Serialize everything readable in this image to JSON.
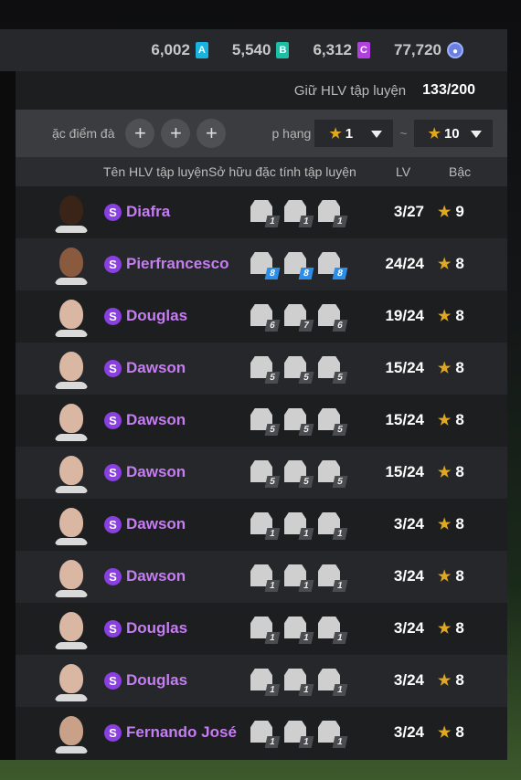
{
  "colors": {
    "accent_purple": "#c67cf2",
    "star_gold": "#e0a820",
    "badge_a": "#19b3e0",
    "badge_b": "#1bbfa5",
    "badge_c": "#b33fe0",
    "trait_blue": "#2d8ee8"
  },
  "currencies": [
    {
      "value": "6,002",
      "badge": "A",
      "color": "#19b3e0"
    },
    {
      "value": "5,540",
      "badge": "B",
      "color": "#1bbfa5"
    },
    {
      "value": "6,312",
      "badge": "C",
      "color": "#b33fe0"
    },
    {
      "value": "77,720",
      "badge": "coin-icon",
      "color": "#6b7fe0"
    }
  ],
  "keep": {
    "label": "Giữ HLV tập luyện",
    "value": "133/200"
  },
  "filters": {
    "traits_label": "ặc điểm đà",
    "rank_label": "p hạng",
    "min_rank": "1",
    "max_rank": "10",
    "tilde": "~"
  },
  "headers": {
    "name": "Tên HLV tập luyện",
    "traits": "Sở hữu đặc tính tập luyện",
    "lv": "LV",
    "rank": "Bậc"
  },
  "players": [
    {
      "name": "Diafra",
      "lv": "3/27",
      "rank": "9",
      "skin": "#3a2418",
      "traits": [
        {
          "lv": "1",
          "blue": false
        },
        {
          "lv": "1",
          "blue": false
        },
        {
          "lv": "1",
          "blue": false
        }
      ]
    },
    {
      "name": "Pierfrancesco",
      "lv": "24/24",
      "rank": "8",
      "skin": "#8a5a3e",
      "traits": [
        {
          "lv": "8",
          "blue": true
        },
        {
          "lv": "8",
          "blue": true
        },
        {
          "lv": "8",
          "blue": true
        }
      ]
    },
    {
      "name": "Douglas",
      "lv": "19/24",
      "rank": "8",
      "skin": "#d9b7a3",
      "traits": [
        {
          "lv": "6",
          "blue": false
        },
        {
          "lv": "7",
          "blue": false
        },
        {
          "lv": "6",
          "blue": false
        }
      ]
    },
    {
      "name": "Dawson",
      "lv": "15/24",
      "rank": "8",
      "skin": "#d9b7a3",
      "traits": [
        {
          "lv": "5",
          "blue": false
        },
        {
          "lv": "5",
          "blue": false
        },
        {
          "lv": "5",
          "blue": false
        }
      ]
    },
    {
      "name": "Dawson",
      "lv": "15/24",
      "rank": "8",
      "skin": "#d9b7a3",
      "traits": [
        {
          "lv": "5",
          "blue": false
        },
        {
          "lv": "5",
          "blue": false
        },
        {
          "lv": "5",
          "blue": false
        }
      ]
    },
    {
      "name": "Dawson",
      "lv": "15/24",
      "rank": "8",
      "skin": "#d9b7a3",
      "traits": [
        {
          "lv": "5",
          "blue": false
        },
        {
          "lv": "5",
          "blue": false
        },
        {
          "lv": "5",
          "blue": false
        }
      ]
    },
    {
      "name": "Dawson",
      "lv": "3/24",
      "rank": "8",
      "skin": "#d9b7a3",
      "traits": [
        {
          "lv": "1",
          "blue": false
        },
        {
          "lv": "1",
          "blue": false
        },
        {
          "lv": "1",
          "blue": false
        }
      ]
    },
    {
      "name": "Dawson",
      "lv": "3/24",
      "rank": "8",
      "skin": "#d9b7a3",
      "traits": [
        {
          "lv": "1",
          "blue": false
        },
        {
          "lv": "1",
          "blue": false
        },
        {
          "lv": "1",
          "blue": false
        }
      ]
    },
    {
      "name": "Douglas",
      "lv": "3/24",
      "rank": "8",
      "skin": "#d9b7a3",
      "traits": [
        {
          "lv": "1",
          "blue": false
        },
        {
          "lv": "1",
          "blue": false
        },
        {
          "lv": "1",
          "blue": false
        }
      ]
    },
    {
      "name": "Douglas",
      "lv": "3/24",
      "rank": "8",
      "skin": "#d9b7a3",
      "traits": [
        {
          "lv": "1",
          "blue": false
        },
        {
          "lv": "1",
          "blue": false
        },
        {
          "lv": "1",
          "blue": false
        }
      ]
    },
    {
      "name": "Fernando José",
      "lv": "3/24",
      "rank": "8",
      "skin": "#c9a088",
      "traits": [
        {
          "lv": "1",
          "blue": false
        },
        {
          "lv": "1",
          "blue": false
        },
        {
          "lv": "1",
          "blue": false
        }
      ]
    }
  ]
}
